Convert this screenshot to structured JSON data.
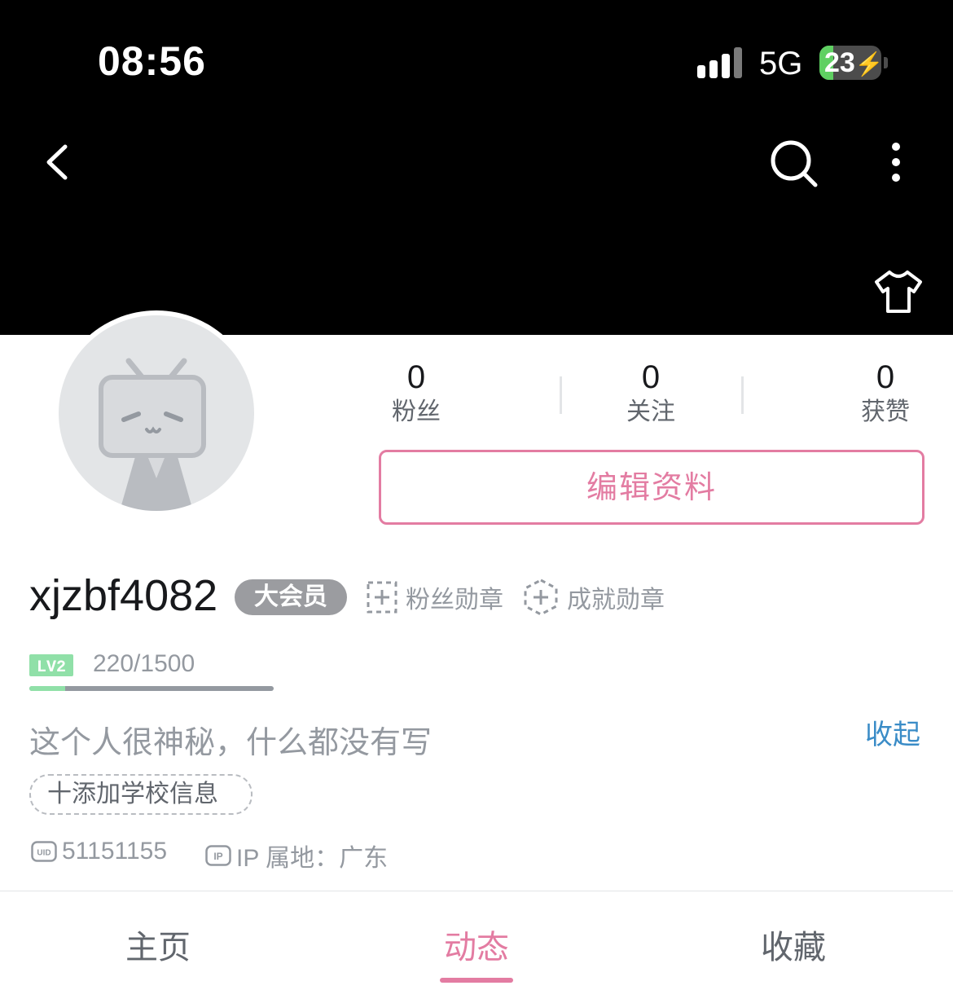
{
  "status_bar": {
    "time": "08:56",
    "network": "5G",
    "battery": "23"
  },
  "profile": {
    "username": "xjzbf4082",
    "vip_label": "大会员",
    "fan_medal": "粉丝勋章",
    "achievement_medal": "成就勋章",
    "level": {
      "label": "LV2",
      "progress_text": "220/1500",
      "progress": 0.147
    },
    "bio": "这个人很神秘，什么都没有写",
    "collapse_label": "收起",
    "school_label": "十添加学校信息",
    "uid": "51151155",
    "ip_location": "IP 属地：广东"
  },
  "stats": [
    {
      "value": "0",
      "label": "粉丝"
    },
    {
      "value": "0",
      "label": "关注"
    },
    {
      "value": "0",
      "label": "获赞"
    }
  ],
  "edit_button": "编辑资料",
  "tabs": [
    {
      "label": "主页",
      "active": false
    },
    {
      "label": "动态",
      "active": true
    },
    {
      "label": "收藏",
      "active": false
    }
  ],
  "colors": {
    "accent": "#e37ca2",
    "link": "#3a8cc7",
    "level_green": "#90e0a8"
  }
}
